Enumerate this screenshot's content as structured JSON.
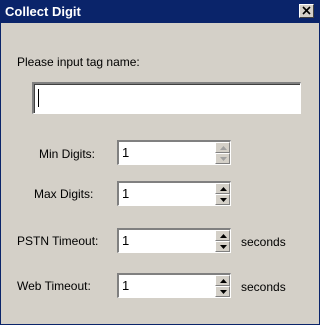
{
  "window": {
    "title": "Collect Digit"
  },
  "tag_name": {
    "label": "Please input tag name:",
    "value": ""
  },
  "min_digits": {
    "label": "Min Digits:",
    "value": "1"
  },
  "max_digits": {
    "label": "Max Digits:",
    "value": "1"
  },
  "pstn_timeout": {
    "label": "PSTN Timeout:",
    "value": "1",
    "unit": "seconds"
  },
  "web_timeout": {
    "label": "Web Timeout:",
    "value": "1",
    "unit": "seconds"
  },
  "colors": {
    "titlebar": "#0a246a",
    "dialog_background": "#d4d0c8"
  },
  "icons": {
    "close": "close-icon",
    "up": "spin-up-arrow-icon",
    "down": "spin-down-arrow-icon"
  }
}
